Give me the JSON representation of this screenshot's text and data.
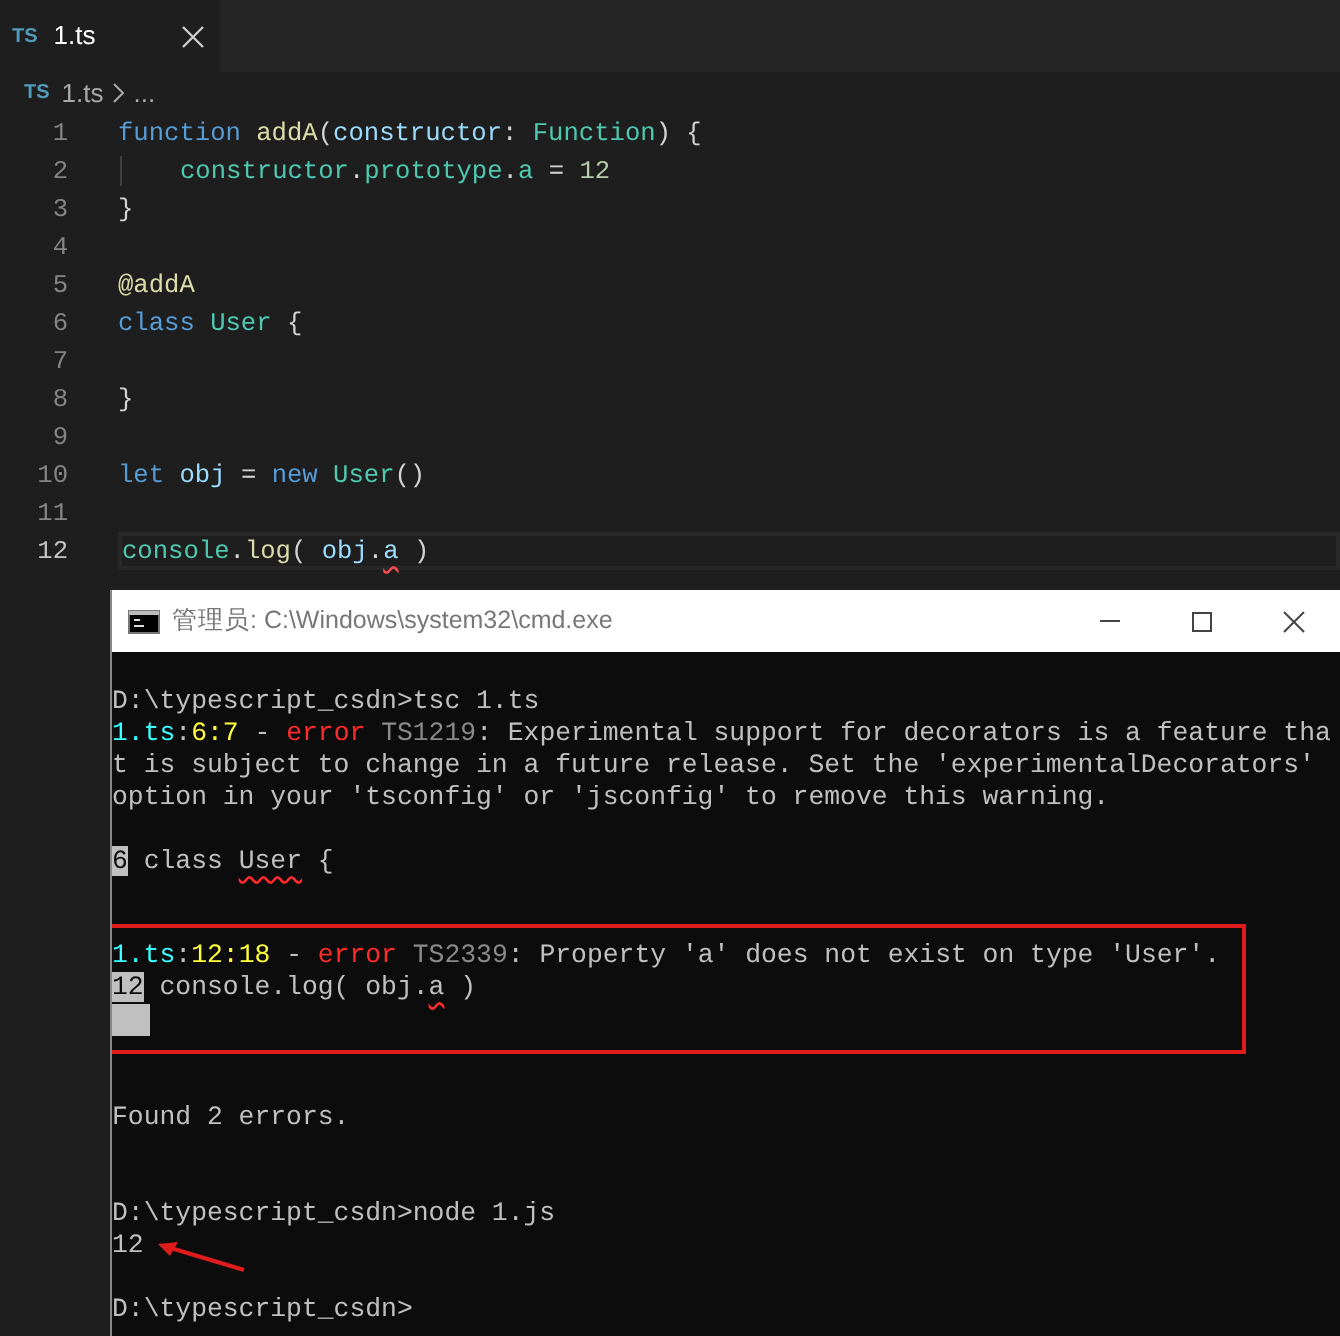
{
  "editor": {
    "tabs": [
      {
        "badge": "TS",
        "label": "1.ts",
        "selected": true
      }
    ],
    "breadcrumb": {
      "badge": "TS",
      "file": "1.ts",
      "ellipsis": "..."
    },
    "lines": [
      {
        "number": "1",
        "tokens": [
          {
            "kind": "kw",
            "text": "function "
          },
          {
            "kind": "fn",
            "text": "addA"
          },
          {
            "kind": "p",
            "text": "("
          },
          {
            "kind": "var",
            "text": "constructor"
          },
          {
            "kind": "p",
            "text": ": "
          },
          {
            "kind": "type",
            "text": "Function"
          },
          {
            "kind": "p",
            "text": ") {"
          }
        ]
      },
      {
        "number": "2",
        "indent": true,
        "tokens": [
          {
            "kind": "type",
            "text": "constructor"
          },
          {
            "kind": "p",
            "text": "."
          },
          {
            "kind": "type",
            "text": "prototype"
          },
          {
            "kind": "p",
            "text": "."
          },
          {
            "kind": "type",
            "text": "a"
          },
          {
            "kind": "p",
            "text": " = "
          },
          {
            "kind": "num",
            "text": "12"
          }
        ]
      },
      {
        "number": "3",
        "tokens": [
          {
            "kind": "p",
            "text": "}"
          }
        ]
      },
      {
        "number": "4"
      },
      {
        "number": "5",
        "tokens": [
          {
            "kind": "fn",
            "text": "@addA"
          }
        ]
      },
      {
        "number": "6",
        "tokens": [
          {
            "kind": "kw",
            "text": "class "
          },
          {
            "kind": "type",
            "text": "User"
          },
          {
            "kind": "p",
            "text": " {"
          }
        ]
      },
      {
        "number": "7"
      },
      {
        "number": "8",
        "tokens": [
          {
            "kind": "p",
            "text": "}"
          }
        ]
      },
      {
        "number": "9"
      },
      {
        "number": "10",
        "tokens": [
          {
            "kind": "kw",
            "text": "let "
          },
          {
            "kind": "var",
            "text": "obj"
          },
          {
            "kind": "p",
            "text": " = "
          },
          {
            "kind": "kw",
            "text": "new "
          },
          {
            "kind": "type",
            "text": "User"
          },
          {
            "kind": "p",
            "text": "()"
          }
        ]
      },
      {
        "number": "11"
      },
      {
        "number": "12",
        "current": true,
        "tokens": [
          {
            "kind": "type",
            "text": "console"
          },
          {
            "kind": "p",
            "text": "."
          },
          {
            "kind": "fn",
            "text": "log"
          },
          {
            "kind": "p",
            "text": "( "
          },
          {
            "kind": "var",
            "text": "obj"
          },
          {
            "kind": "p",
            "text": "."
          },
          {
            "kind": "squig",
            "text": "a"
          },
          {
            "kind": "p",
            "text": " )"
          }
        ]
      }
    ]
  },
  "terminal": {
    "title": "管理员: C:\\Windows\\system32\\cmd.exe",
    "lines": [
      {
        "kind": "line",
        "segments": [
          {
            "kind": "t",
            "text": "D:\\typescript_csdn>tsc 1.ts"
          }
        ]
      },
      {
        "kind": "line",
        "segments": [
          {
            "kind": "file",
            "text": "1.ts"
          },
          {
            "kind": "t",
            "text": ":"
          },
          {
            "kind": "pos",
            "text": "6:7"
          },
          {
            "kind": "t",
            "text": " - "
          },
          {
            "kind": "err",
            "text": "error"
          },
          {
            "kind": "code",
            "text": " TS1219"
          },
          {
            "kind": "t",
            "text": ": Experimental support for decorators is a feature tha"
          }
        ]
      },
      {
        "kind": "line",
        "segments": [
          {
            "kind": "t",
            "text": "t is subject to change in a future release. Set the 'experimentalDecorators'"
          }
        ]
      },
      {
        "kind": "line",
        "segments": [
          {
            "kind": "t",
            "text": "option in your 'tsconfig' or 'jsconfig' to remove this warning."
          }
        ]
      },
      {
        "kind": "blank"
      },
      {
        "kind": "line",
        "segments": [
          {
            "kind": "gutter",
            "text": "6"
          },
          {
            "kind": "t",
            "text": " class "
          },
          {
            "kind": "squig",
            "text": "User"
          },
          {
            "kind": "t",
            "text": " {"
          }
        ]
      },
      {
        "kind": "blank"
      },
      {
        "kind": "box",
        "lines": [
          {
            "kind": "line",
            "segments": [
              {
                "kind": "file",
                "text": "1.ts"
              },
              {
                "kind": "t",
                "text": ":"
              },
              {
                "kind": "pos",
                "text": "12:18"
              },
              {
                "kind": "t",
                "text": " - "
              },
              {
                "kind": "err",
                "text": "error"
              },
              {
                "kind": "code",
                "text": " TS2339"
              },
              {
                "kind": "t",
                "text": ": Property 'a' does not exist on type 'User'."
              }
            ]
          },
          {
            "kind": "line",
            "segments": [
              {
                "kind": "gutter",
                "text": "12"
              },
              {
                "kind": "t",
                "text": " console.log( obj."
              },
              {
                "kind": "squig",
                "text": "a"
              },
              {
                "kind": "t",
                "text": " )"
              }
            ]
          },
          {
            "kind": "gutter_fill"
          }
        ]
      },
      {
        "kind": "blank"
      },
      {
        "kind": "line",
        "segments": [
          {
            "kind": "t",
            "text": "Found 2 errors."
          }
        ]
      },
      {
        "kind": "blank"
      },
      {
        "kind": "blank"
      },
      {
        "kind": "line",
        "segments": [
          {
            "kind": "t",
            "text": "D:\\typescript_csdn>node 1.js"
          }
        ]
      },
      {
        "kind": "line",
        "arrow": true,
        "segments": [
          {
            "kind": "t",
            "text": "12"
          }
        ]
      },
      {
        "kind": "blank"
      },
      {
        "kind": "line",
        "segments": [
          {
            "kind": "t",
            "text": "D:\\typescript_csdn>"
          }
        ]
      }
    ]
  }
}
